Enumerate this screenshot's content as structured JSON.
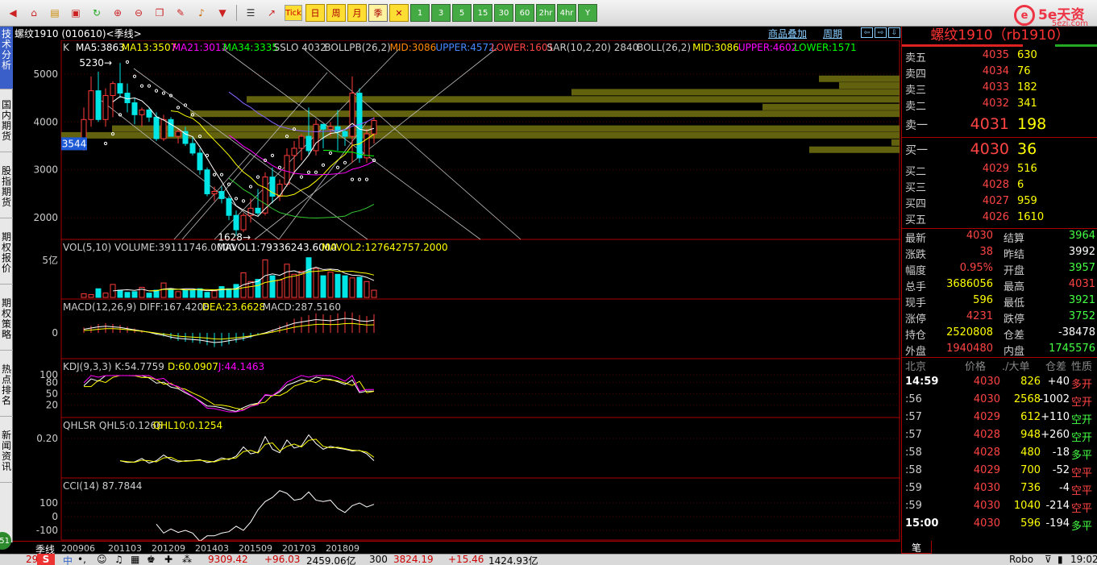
{
  "toolbar": {
    "tick_label": "Tick",
    "day_label": "日",
    "week_label": "周",
    "month_label": "月",
    "season_label": "季",
    "period_buttons": [
      "1",
      "3",
      "5",
      "15",
      "30",
      "60",
      "2hr",
      "4hr",
      "Y"
    ]
  },
  "logo": {
    "ring": "e",
    "name": "5e天资",
    "domain": "5ezj.com"
  },
  "sidebar": {
    "tabs": [
      "技术分析",
      "国内期货",
      "股指期货",
      "期权报价",
      "期权策略",
      "热点排名",
      "新闻资讯"
    ],
    "circle": "51"
  },
  "chart": {
    "title": "螺纹1910 (010610)<季线>",
    "link_overlay": "商品叠加",
    "link_period": "周期",
    "nav": [
      "⇦",
      "⇨",
      "⇩"
    ],
    "main_indicator": {
      "prefix": "K",
      "items": [
        {
          "label": "MA5:3863",
          "color": "#ffffff"
        },
        {
          "label": "MA13:3507",
          "color": "#ffff00"
        },
        {
          "label": "MA21:3013",
          "color": "#ff00ff"
        },
        {
          "label": "MA34:3335",
          "color": "#00ff00"
        },
        {
          "label": "SSLO 4032",
          "color": "#cccccc"
        },
        {
          "label": "BOLLPB(26,2)",
          "color": "#cccccc"
        },
        {
          "label": "MID:3086",
          "color": "#ff8800"
        },
        {
          "label": "UPPER:4572",
          "color": "#4488ff"
        },
        {
          "label": "LOWER:1601",
          "color": "#ff4444"
        },
        {
          "label": "SAR(10,2,20) 2840",
          "color": "#cccccc"
        },
        {
          "label": "BOLL(26,2)",
          "color": "#cccccc"
        },
        {
          "label": "MID:3086",
          "color": "#ffff00"
        },
        {
          "label": "UPPER:4602",
          "color": "#ff00ff"
        },
        {
          "label": "LOWER:1571",
          "color": "#00ff00"
        }
      ],
      "y_ticks": [
        "5000",
        "4000",
        "3000",
        "2000"
      ],
      "high_label": "5230",
      "low_label": "1628",
      "current_price_box": "3544"
    },
    "vol_indicator": {
      "items": [
        {
          "label": "VOL(5,10) VOLUME:39111746.0000",
          "color": "#cccccc"
        },
        {
          "label": "MAVOL1:79336243.6000",
          "color": "#ffffff"
        },
        {
          "label": "MAVOL2:127642757.2000",
          "color": "#ffff00"
        }
      ],
      "y_tick": "5亿"
    },
    "macd_indicator": {
      "items": [
        {
          "label": "MACD(12,26,9) DIFF:167.4208",
          "color": "#cccccc"
        },
        {
          "label": "DEA:23.6628",
          "color": "#ffff00"
        },
        {
          "label": "MACD:287.5160",
          "color": "#cccccc"
        }
      ],
      "y_tick": "0"
    },
    "kdj_indicator": {
      "items": [
        {
          "label": "KDJ(9,3,3) K:54.7759",
          "color": "#cccccc"
        },
        {
          "label": "D:60.0907",
          "color": "#ffff00"
        },
        {
          "label": "J:44.1463",
          "color": "#ff00ff"
        }
      ],
      "y_ticks": [
        "100",
        "80",
        "50",
        "20"
      ]
    },
    "qhlsr_indicator": {
      "items": [
        {
          "label": "QHLSR QHL5:0.1266",
          "color": "#cccccc"
        },
        {
          "label": "QHL10:0.1254",
          "color": "#ffff00"
        }
      ],
      "y_tick": "0.20"
    },
    "cci_indicator": {
      "items": [
        {
          "label": "CCI(14) 87.7844",
          "color": "#cccccc"
        }
      ],
      "y_ticks": [
        "100",
        "0",
        "-100"
      ]
    },
    "period_label": "季线",
    "time_ticks": [
      "200906",
      "201103",
      "201209",
      "201403",
      "201509",
      "201703",
      "201809"
    ]
  },
  "chart_data": {
    "type": "candlestick",
    "period": "quarterly",
    "ylim": [
      1600,
      5400
    ],
    "candles": [
      {
        "o": 3450,
        "h": 4300,
        "l": 3400,
        "c": 4050
      },
      {
        "o": 4050,
        "h": 4950,
        "l": 3900,
        "c": 4650
      },
      {
        "o": 4650,
        "h": 5050,
        "l": 4000,
        "c": 4050
      },
      {
        "o": 4050,
        "h": 4700,
        "l": 3900,
        "c": 4550
      },
      {
        "o": 4550,
        "h": 4850,
        "l": 4100,
        "c": 4800
      },
      {
        "o": 4800,
        "h": 5230,
        "l": 4500,
        "c": 4600
      },
      {
        "o": 4600,
        "h": 4800,
        "l": 4200,
        "c": 4400
      },
      {
        "o": 4400,
        "h": 4500,
        "l": 3950,
        "c": 4150
      },
      {
        "o": 4150,
        "h": 4300,
        "l": 3900,
        "c": 4250
      },
      {
        "o": 4250,
        "h": 4300,
        "l": 4000,
        "c": 4100
      },
      {
        "o": 4100,
        "h": 4200,
        "l": 3600,
        "c": 3650
      },
      {
        "o": 3650,
        "h": 4150,
        "l": 3600,
        "c": 4050
      },
      {
        "o": 4050,
        "h": 4100,
        "l": 3700,
        "c": 3700
      },
      {
        "o": 3700,
        "h": 3850,
        "l": 3550,
        "c": 3800
      },
      {
        "o": 3800,
        "h": 3900,
        "l": 3500,
        "c": 3550
      },
      {
        "o": 3550,
        "h": 3700,
        "l": 3300,
        "c": 3350
      },
      {
        "o": 3350,
        "h": 3450,
        "l": 2900,
        "c": 3000
      },
      {
        "o": 3000,
        "h": 3050,
        "l": 2450,
        "c": 2500
      },
      {
        "o": 2500,
        "h": 2650,
        "l": 2350,
        "c": 2550
      },
      {
        "o": 2550,
        "h": 2650,
        "l": 2300,
        "c": 2400
      },
      {
        "o": 2400,
        "h": 2450,
        "l": 1950,
        "c": 2050
      },
      {
        "o": 2050,
        "h": 2150,
        "l": 1628,
        "c": 1750
      },
      {
        "o": 1750,
        "h": 2100,
        "l": 1700,
        "c": 2050
      },
      {
        "o": 2050,
        "h": 2400,
        "l": 1900,
        "c": 2200
      },
      {
        "o": 2200,
        "h": 2600,
        "l": 2050,
        "c": 2100
      },
      {
        "o": 2100,
        "h": 2950,
        "l": 2050,
        "c": 2850
      },
      {
        "o": 2850,
        "h": 3050,
        "l": 2300,
        "c": 2450
      },
      {
        "o": 2450,
        "h": 2800,
        "l": 2350,
        "c": 2700
      },
      {
        "o": 2700,
        "h": 3450,
        "l": 2650,
        "c": 3300
      },
      {
        "o": 3300,
        "h": 3600,
        "l": 2900,
        "c": 3450
      },
      {
        "o": 3450,
        "h": 3750,
        "l": 3200,
        "c": 3700
      },
      {
        "o": 3700,
        "h": 4300,
        "l": 3300,
        "c": 3400
      },
      {
        "o": 3400,
        "h": 4050,
        "l": 3300,
        "c": 3950
      },
      {
        "o": 3950,
        "h": 3950,
        "l": 3450,
        "c": 3850
      },
      {
        "o": 3850,
        "h": 4000,
        "l": 3700,
        "c": 3900
      },
      {
        "o": 3900,
        "h": 4250,
        "l": 3400,
        "c": 3800
      },
      {
        "o": 3800,
        "h": 3850,
        "l": 3500,
        "c": 3700
      },
      {
        "o": 3700,
        "h": 4950,
        "l": 3150,
        "c": 4600
      },
      {
        "o": 4600,
        "h": 4700,
        "l": 3150,
        "c": 3250
      },
      {
        "o": 3250,
        "h": 3850,
        "l": 3150,
        "c": 3750
      },
      {
        "o": 3750,
        "h": 4100,
        "l": 3550,
        "c": 4030
      }
    ],
    "volume_bars": [
      0.05,
      0.04,
      0.12,
      0.06,
      0.18,
      0.1,
      0.07,
      0.08,
      0.14,
      0.06,
      0.1,
      0.2,
      0.12,
      0.08,
      0.1,
      0.1,
      0.12,
      0.07,
      0.09,
      0.15,
      0.12,
      0.18,
      0.34,
      0.22,
      0.25,
      0.52,
      0.3,
      0.24,
      0.46,
      0.32,
      0.36,
      0.55,
      0.4,
      0.3,
      0.35,
      0.32,
      0.3,
      0.27,
      0.28,
      0.22,
      0.1
    ],
    "macd_bars": [
      30,
      40,
      50,
      55,
      50,
      45,
      35,
      25,
      15,
      5,
      -10,
      -20,
      -35,
      -45,
      -50,
      -55,
      -60,
      -70,
      -80,
      -75,
      -65,
      -55,
      -45,
      -30,
      -15,
      0,
      20,
      40,
      60,
      80,
      90,
      100,
      110,
      105,
      100,
      110,
      120,
      115,
      100,
      95,
      105
    ],
    "cci_values": [
      null,
      null,
      null,
      null,
      null,
      null,
      null,
      null,
      null,
      null,
      -55,
      -120,
      -90,
      -115,
      -100,
      -120,
      -180,
      -140,
      -140,
      -120,
      -110,
      -70,
      -100,
      -40,
      50,
      110,
      140,
      190,
      170,
      120,
      130,
      180,
      120,
      110,
      120,
      60,
      30,
      80,
      100,
      70,
      90
    ]
  },
  "right_panel": {
    "title": "螺纹1910（rb1910）",
    "asks": [
      {
        "label": "卖五",
        "price": "4035",
        "vol": "630"
      },
      {
        "label": "卖四",
        "price": "4034",
        "vol": "76"
      },
      {
        "label": "卖三",
        "price": "4033",
        "vol": "182"
      },
      {
        "label": "卖二",
        "price": "4032",
        "vol": "341"
      }
    ],
    "ask1": {
      "label": "卖一",
      "price": "4031",
      "vol": "198"
    },
    "bid1": {
      "label": "买一",
      "price": "4030",
      "vol": "36"
    },
    "bids": [
      {
        "label": "买二",
        "price": "4029",
        "vol": "516"
      },
      {
        "label": "买三",
        "price": "4028",
        "vol": "6"
      },
      {
        "label": "买四",
        "price": "4027",
        "vol": "959"
      },
      {
        "label": "买五",
        "price": "4026",
        "vol": "1610"
      }
    ],
    "stats": [
      {
        "l1": "最新",
        "v1": "4030",
        "c1": "#ff4444",
        "l2": "结算",
        "v2": "3964",
        "c2": "#44ff44"
      },
      {
        "l1": "涨跌",
        "v1": "38",
        "c1": "#ff4444",
        "l2": "昨结",
        "v2": "3992",
        "c2": "#ffffff"
      },
      {
        "l1": "幅度",
        "v1": "0.95%",
        "c1": "#ff4444",
        "l2": "开盘",
        "v2": "3957",
        "c2": "#44ff44"
      },
      {
        "l1": "总手",
        "v1": "3686056",
        "c1": "#ffff00",
        "l2": "最高",
        "v2": "4031",
        "c2": "#ff4444"
      },
      {
        "l1": "现手",
        "v1": "596",
        "c1": "#ffff00",
        "l2": "最低",
        "v2": "3921",
        "c2": "#44ff44"
      },
      {
        "l1": "涨停",
        "v1": "4231",
        "c1": "#ff4444",
        "l2": "跌停",
        "v2": "3752",
        "c2": "#44ff44"
      },
      {
        "l1": "持仓",
        "v1": "2520808",
        "c1": "#ffff00",
        "l2": "仓差",
        "v2": "-38478",
        "c2": "#ffffff"
      },
      {
        "l1": "外盘",
        "v1": "1940480",
        "c1": "#ff4444",
        "l2": "内盘",
        "v2": "1745576",
        "c2": "#44ff44"
      }
    ],
    "tick_header": {
      "city": "北京",
      "price": "价格",
      "vol": "./大单",
      "chg": "仓差",
      "nature": "性质"
    },
    "ticks": [
      {
        "time": "14:59",
        "price": "4030",
        "vol": "826",
        "chg": "+40",
        "nature": "多开",
        "ncolor": "#ff4444",
        "big": true
      },
      {
        "time": ":56",
        "price": "4030",
        "vol": "2568",
        "chg": "-1002",
        "nature": "空开",
        "ncolor": "#ff4444",
        "big": false
      },
      {
        "time": ":57",
        "price": "4029",
        "vol": "612",
        "chg": "+110",
        "nature": "空开",
        "ncolor": "#44ff44",
        "big": false
      },
      {
        "time": ":57",
        "price": "4028",
        "vol": "948",
        "chg": "+260",
        "nature": "空开",
        "ncolor": "#44ff44",
        "big": false
      },
      {
        "time": ":58",
        "price": "4028",
        "vol": "480",
        "chg": "-18",
        "nature": "多平",
        "ncolor": "#44ff44",
        "big": false
      },
      {
        "time": ":58",
        "price": "4029",
        "vol": "700",
        "chg": "-52",
        "nature": "空平",
        "ncolor": "#ff4444",
        "big": false
      },
      {
        "time": ":59",
        "price": "4030",
        "vol": "736",
        "chg": "-4",
        "nature": "空平",
        "ncolor": "#ff4444",
        "big": false
      },
      {
        "time": ":59",
        "price": "4030",
        "vol": "1040",
        "chg": "-214",
        "nature": "空平",
        "ncolor": "#ff4444",
        "big": false
      },
      {
        "time": "15:00",
        "price": "4030",
        "vol": "596",
        "chg": "-194",
        "nature": "多平",
        "ncolor": "#44ff44",
        "big": true
      }
    ],
    "bottom_tab": "笔"
  },
  "status_bar": {
    "items": [
      {
        "text": "29",
        "color": "#cc0000"
      },
      {
        "text": "9309.42",
        "color": "#cc0000"
      },
      {
        "text": "+96.03",
        "color": "#cc0000"
      },
      {
        "text": "2459.06亿",
        "color": "#000000"
      },
      {
        "text": "300",
        "color": "#000000"
      },
      {
        "text": "3824.19",
        "color": "#cc0000"
      },
      {
        "text": "+15.46",
        "color": "#cc0000"
      },
      {
        "text": "1424.93亿",
        "color": "#000000"
      },
      {
        "text": "Robo",
        "color": "#000000"
      },
      {
        "text": "19:02",
        "color": "#000000"
      }
    ]
  }
}
